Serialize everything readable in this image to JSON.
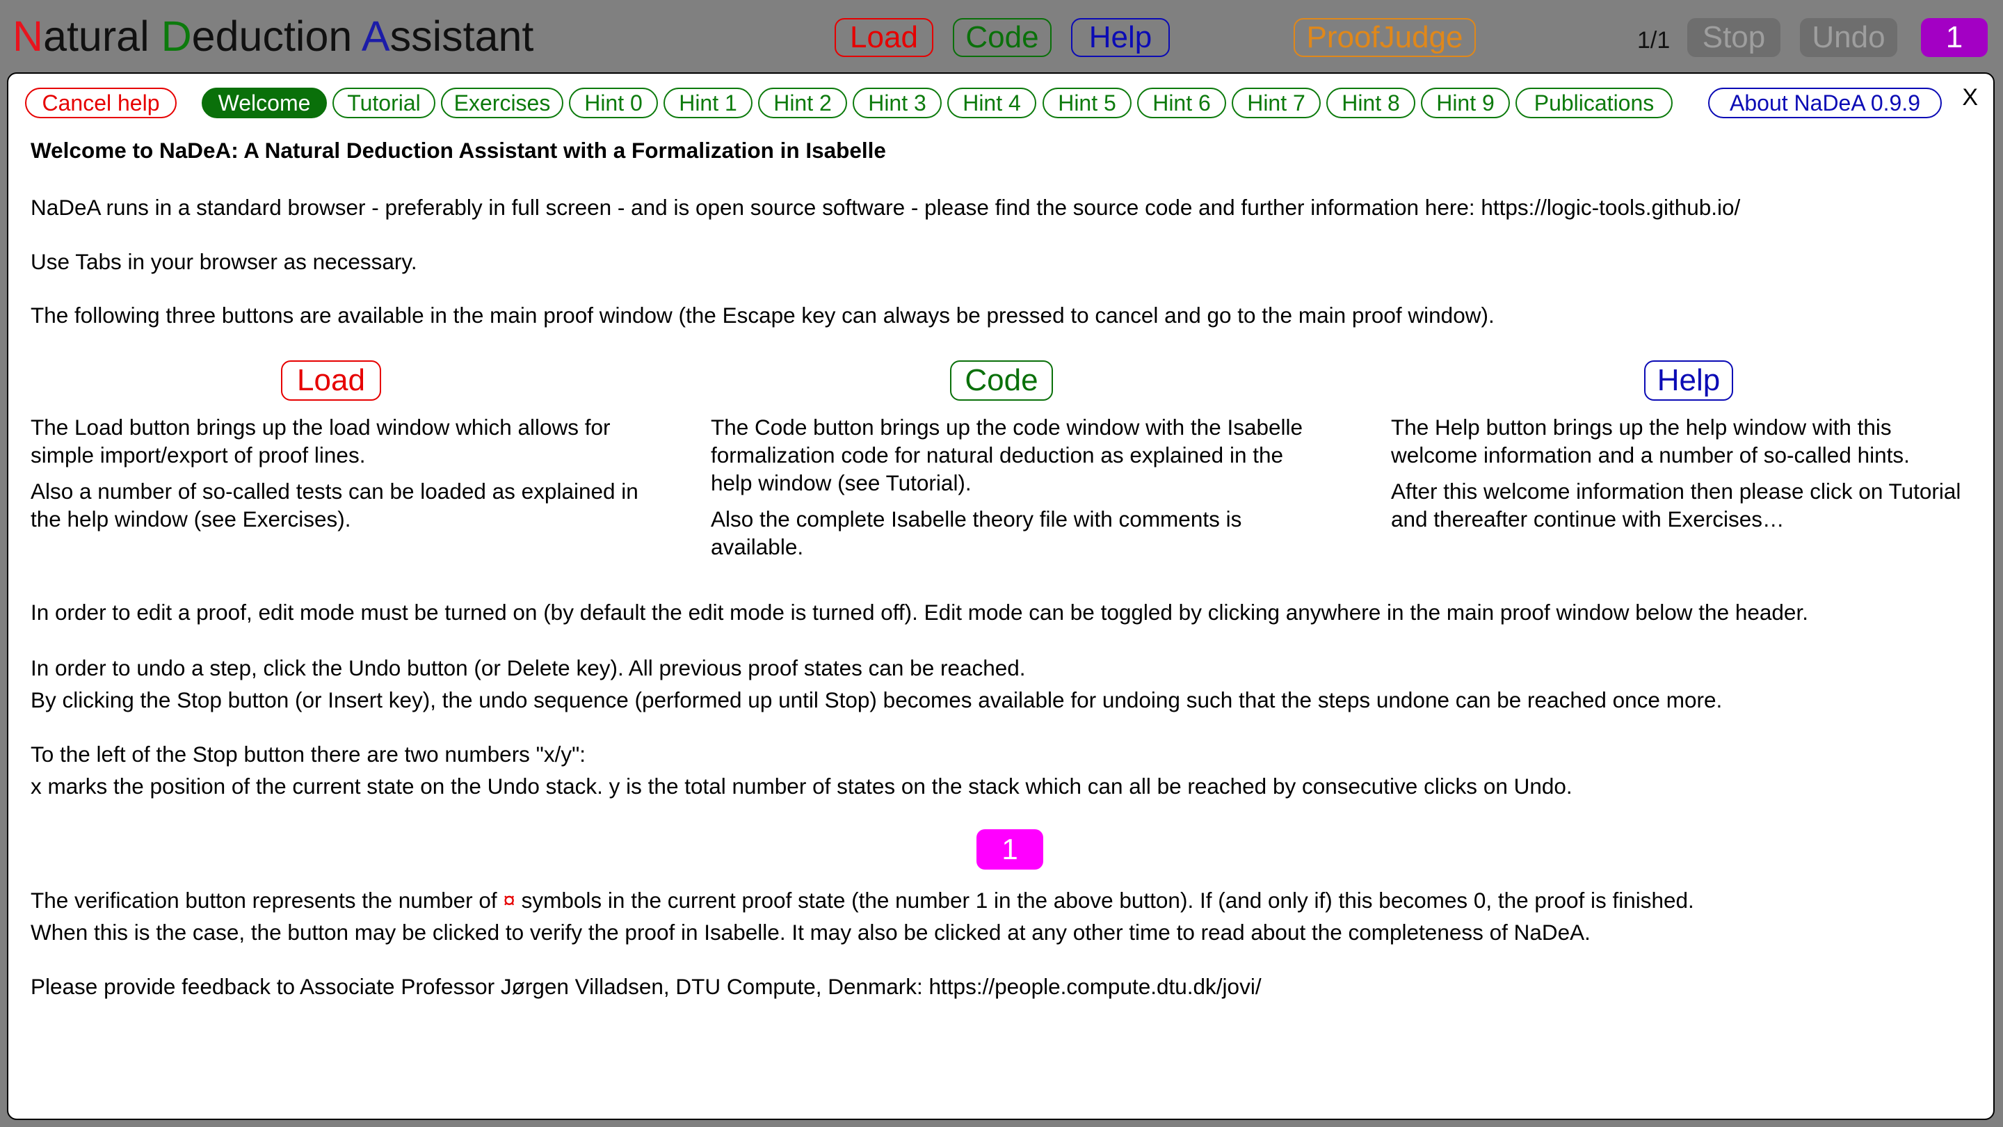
{
  "header": {
    "title_parts": [
      {
        "text": "N",
        "color": "#e8141e"
      },
      {
        "text": "atural ",
        "color": "#111111"
      },
      {
        "text": "D",
        "color": "#0c7a0c"
      },
      {
        "text": "eduction ",
        "color": "#111111"
      },
      {
        "text": "A",
        "color": "#1c1ca8"
      },
      {
        "text": "ssistant",
        "color": "#111111"
      }
    ],
    "load_label": "Load",
    "code_label": "Code",
    "help_label": "Help",
    "proofjudge_label": "ProofJudge",
    "state_counter": "1/1",
    "stop_label": "Stop",
    "undo_label": "Undo",
    "verify_label": "1"
  },
  "tabs": {
    "cancel": "Cancel help",
    "welcome": "Welcome",
    "tutorial": "Tutorial",
    "exercises": "Exercises",
    "hints": [
      "Hint 0",
      "Hint 1",
      "Hint 2",
      "Hint 3",
      "Hint 4",
      "Hint 5",
      "Hint 6",
      "Hint 7",
      "Hint 8",
      "Hint 9"
    ],
    "publications": "Publications",
    "about": "About NaDeA 0.9.9",
    "close": "X"
  },
  "welcome": {
    "heading": "Welcome to NaDeA: A Natural Deduction Assistant with a Formalization in Isabelle",
    "intro": "NaDeA runs in a standard browser - preferably in full screen - and is open source software - please find the source code and further information here: https://logic-tools.github.io/",
    "tabs_note": "Use Tabs in your browser as necessary.",
    "buttons_intro": "The following three buttons are available in the main proof window (the Escape key can always be pressed to cancel and go to the main proof window).",
    "columns": [
      {
        "button": "Load",
        "p1": "The Load button brings up the load window which allows for simple import/export of proof lines.",
        "p2": "Also a number of so-called tests can be loaded as explained in the help window (see Exercises)."
      },
      {
        "button": "Code",
        "p1": "The Code button brings up the code window with the Isabelle formalization code for natural deduction as explained in the help window (see Tutorial).",
        "p2": "Also the complete Isabelle theory file with comments is available."
      },
      {
        "button": "Help",
        "p1": "The Help button brings up the help window with this welcome information and a number of so-called hints.",
        "p2": "After this welcome information then please click on Tutorial and thereafter continue with Exercises…"
      }
    ],
    "edit_mode": "In order to edit a proof, edit mode must be turned on (by default the edit mode is turned off). Edit mode can be toggled by clicking anywhere in the main proof window below the header.",
    "undo_1": "In order to undo a step, click the Undo button (or Delete key). All previous proof states can be reached.",
    "undo_2": "By clicking the Stop button (or Insert key), the undo sequence (performed up until Stop) becomes available for undoing such that the steps undone can be reached once more.",
    "xy_1": "To the left of the Stop button there are two numbers \"x/y\":",
    "xy_2": "x marks the position of the current state on the Undo stack. y is the total number of states on the stack which can all be reached by consecutive clicks on Undo.",
    "verify_button": "1",
    "verify_1a": "The verification button represents the number of ",
    "verify_symbol": "¤",
    "verify_1b": " symbols in the current proof state (the number 1 in the above button). If (and only if) this becomes 0, the proof is finished.",
    "verify_2": "When this is the case, the button may be clicked to verify the proof in Isabelle. It may also be clicked at any other time to read about the completeness of NaDeA.",
    "feedback": "Please provide feedback to Associate Professor Jørgen Villadsen, DTU Compute, Denmark: https://people.compute.dtu.dk/jovi/"
  }
}
